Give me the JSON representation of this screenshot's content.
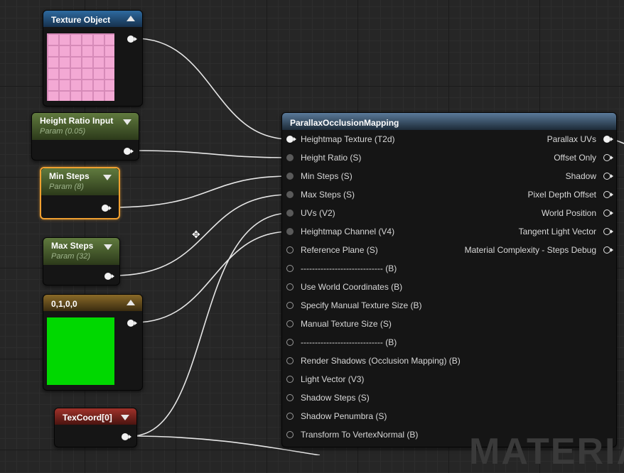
{
  "nodes": {
    "texture_object": {
      "title": "Texture Object",
      "header_color": "#2e6aa0"
    },
    "height_ratio": {
      "title": "Height Ratio Input",
      "subtitle": "Param (0.05)"
    },
    "min_steps": {
      "title": "Min Steps",
      "subtitle": "Param (8)"
    },
    "max_steps": {
      "title": "Max Steps",
      "subtitle": "Param (32)"
    },
    "constant": {
      "title": "0,1,0,0",
      "swatch_color": "#00d800"
    },
    "texcoord": {
      "title": "TexCoord[0]"
    },
    "pom": {
      "title": "ParallaxOcclusionMapping",
      "inputs": [
        "Heightmap Texture (T2d)",
        "Height Ratio (S)",
        "Min Steps (S)",
        "Max Steps (S)",
        "UVs (V2)",
        "Heightmap Channel (V4)",
        "Reference Plane (S)",
        "----------------------------- (B)",
        "Use World Coordinates (B)",
        "Specify Manual Texture Size (B)",
        "Manual Texture Size (S)",
        "----------------------------- (B)",
        "Render Shadows (Occlusion Mapping) (B)",
        "Light Vector (V3)",
        "Shadow Steps (S)",
        "Shadow Penumbra (S)",
        "Transform To VertexNormal (B)"
      ],
      "outputs": [
        "Parallax UVs",
        "Offset Only",
        "Shadow",
        "Pixel Depth Offset",
        "World Position",
        "Tangent Light Vector",
        "Material Complexity - Steps Debug"
      ]
    }
  },
  "selected_node": "Min Steps",
  "watermark": "MATERIA",
  "cursor_icon": "move-cursor-icon"
}
